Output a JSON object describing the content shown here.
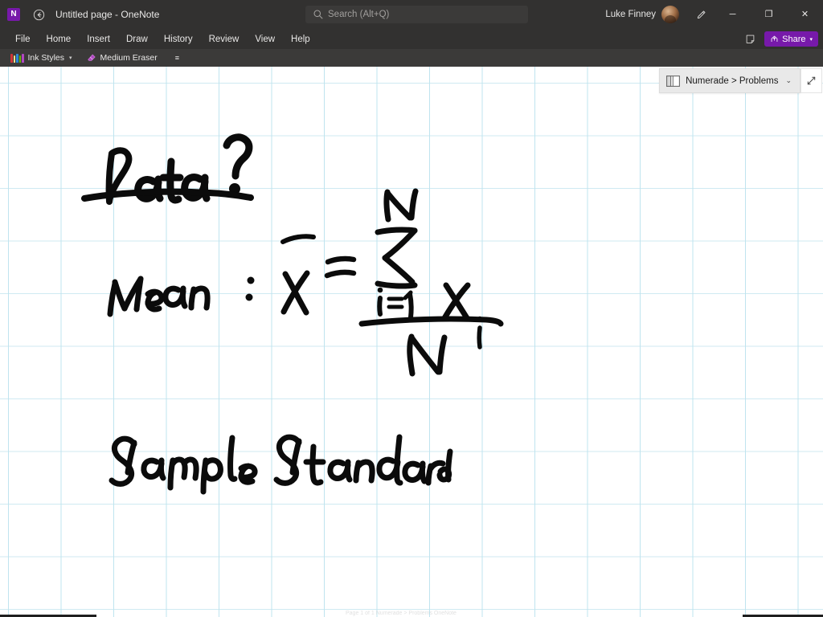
{
  "window": {
    "app_logo_letter": "N",
    "title": "Untitled page  -  OneNote",
    "back_icon": "back-arrow-icon",
    "minimize_glyph": "─",
    "maximize_glyph": "❐",
    "close_glyph": "✕",
    "pen_icon": "pen-icon"
  },
  "search": {
    "placeholder": "Search (Alt+Q)",
    "value": "",
    "icon": "search-icon"
  },
  "account": {
    "name": "Luke Finney",
    "avatar": "user-avatar"
  },
  "ribbon": {
    "tabs": [
      {
        "label": "File"
      },
      {
        "label": "Home"
      },
      {
        "label": "Insert"
      },
      {
        "label": "Draw"
      },
      {
        "label": "History"
      },
      {
        "label": "Review"
      },
      {
        "label": "View"
      },
      {
        "label": "Help"
      }
    ],
    "notes_icon": "sticky-note-icon",
    "share_label": "Share",
    "share_icon": "share-icon",
    "share_caret": "▾",
    "share_color": "#7719aa"
  },
  "ink_toolbar": {
    "ink_styles_label": "Ink Styles",
    "ink_styles_icon": "pens-icon",
    "ink_styles_caret": "▾",
    "eraser_label": "Medium Eraser",
    "eraser_icon": "eraser-icon",
    "overflow_glyph": "≡"
  },
  "canvas": {
    "breadcrumb": "Numerade > Problems",
    "breadcrumb_icon": "notebook-icon",
    "breadcrumb_caret": "⌄",
    "expand_icon": "expand-diagonal-icon",
    "grid_line_color": "#cfeaf2",
    "page_background": "#ffffff"
  },
  "handwriting": {
    "heading": "Data ?",
    "heading_underlined": true,
    "formula_label": "Mean :",
    "formula": "x̄ = ( Σ (i=1 to N) xᵢ ) / N",
    "formula_parts": {
      "mean_word": "Mean",
      "colon": ":",
      "xbar": "x̄",
      "equals": "=",
      "sigma_upper": "N",
      "sigma": "Σ",
      "sigma_lower": "i=1",
      "term": "xᵢ",
      "denominator": "N"
    },
    "second_line": "Sample Standard",
    "ink_color": "#000000"
  },
  "status_bar": {
    "ghost_text": "Page 1 of 1    Numerade > Problems    OneNote"
  }
}
